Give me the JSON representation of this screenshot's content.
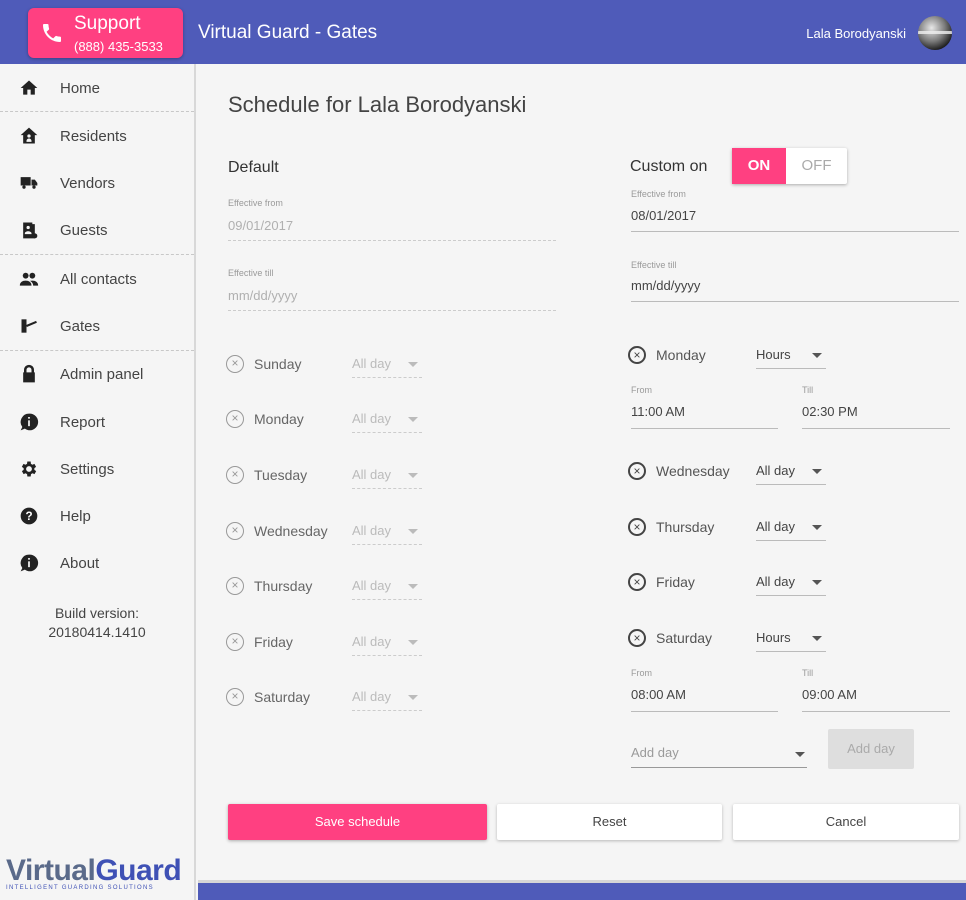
{
  "header": {
    "support_title": "Support",
    "support_phone": "(888) 435-3533",
    "app_title": "Virtual Guard - Gates",
    "user_name": "Lala Borodyanski"
  },
  "sidebar": {
    "items": [
      {
        "label": "Home",
        "icon": "home-icon"
      },
      {
        "label": "Residents",
        "icon": "residents-icon"
      },
      {
        "label": "Vendors",
        "icon": "truck-icon"
      },
      {
        "label": "Guests",
        "icon": "guest-badge-icon"
      },
      {
        "label": "All contacts",
        "icon": "contacts-icon"
      },
      {
        "label": "Gates",
        "icon": "gate-icon"
      },
      {
        "label": "Admin panel",
        "icon": "lock-icon"
      },
      {
        "label": "Report",
        "icon": "info-bubble-icon"
      },
      {
        "label": "Settings",
        "icon": "gear-icon"
      },
      {
        "label": "Help",
        "icon": "help-icon"
      },
      {
        "label": "About",
        "icon": "info-bubble-icon"
      }
    ],
    "build_label": "Build version:",
    "build_number": "20180414.1410",
    "logo_text_virtual": "Virtual",
    "logo_text_guard": "Guard",
    "logo_tagline": "INTELLIGENT GUARDING SOLUTIONS"
  },
  "main": {
    "page_title": "Schedule for Lala Borodyanski",
    "default": {
      "title": "Default",
      "effective_from_label": "Effective from",
      "effective_from_value": "09/01/2017",
      "effective_till_label": "Effective till",
      "effective_till_placeholder": "mm/dd/yyyy",
      "days": [
        {
          "name": "Sunday",
          "mode": "All day"
        },
        {
          "name": "Monday",
          "mode": "All day"
        },
        {
          "name": "Tuesday",
          "mode": "All day"
        },
        {
          "name": "Wednesday",
          "mode": "All day"
        },
        {
          "name": "Thursday",
          "mode": "All day"
        },
        {
          "name": "Friday",
          "mode": "All day"
        },
        {
          "name": "Saturday",
          "mode": "All day"
        }
      ]
    },
    "custom": {
      "title": "Custom on",
      "toggle_on": "ON",
      "toggle_off": "OFF",
      "effective_from_label": "Effective from",
      "effective_from_value": "08/01/2017",
      "effective_till_label": "Effective till",
      "effective_till_placeholder": "mm/dd/yyyy",
      "days": [
        {
          "name": "Monday",
          "mode": "Hours",
          "from_label": "From",
          "from": "11:00 AM",
          "till_label": "Till",
          "till": "02:30 PM"
        },
        {
          "name": "Wednesday",
          "mode": "All day"
        },
        {
          "name": "Thursday",
          "mode": "All day"
        },
        {
          "name": "Friday",
          "mode": "All day"
        },
        {
          "name": "Saturday",
          "mode": "Hours",
          "from_label": "From",
          "from": "08:00 AM",
          "till_label": "Till",
          "till": "09:00 AM"
        }
      ],
      "add_day_placeholder": "Add day",
      "add_day_button": "Add day"
    },
    "buttons": {
      "save": "Save schedule",
      "reset": "Reset",
      "cancel": "Cancel"
    }
  },
  "colors": {
    "header": "#4f5bb9",
    "accent": "#ff4081"
  }
}
